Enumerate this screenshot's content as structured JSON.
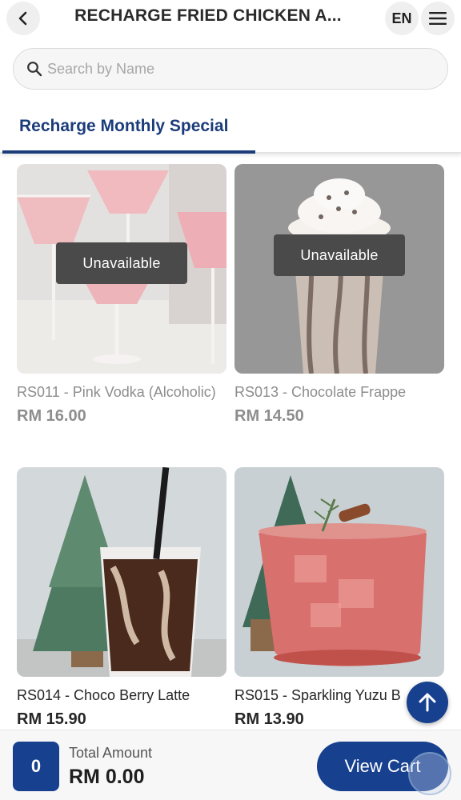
{
  "header": {
    "title": "RECHARGE FRIED CHICKEN A...",
    "language": "EN"
  },
  "search": {
    "placeholder": "Search by Name"
  },
  "tabs": [
    {
      "label": "Recharge Monthly Special",
      "active": true
    }
  ],
  "products": [
    {
      "name": "RS011 - Pink Vodka (Alcoholic)",
      "price": "RM 16.00",
      "status": "Unavailable",
      "image": "pink-cocktail-glasses"
    },
    {
      "name": "RS013 - Chocolate Frappe",
      "price": "RM 14.50",
      "status": "Unavailable",
      "image": "chocolate-frappe-cup"
    },
    {
      "name": "RS014 - Choco Berry Latte",
      "price": "RM 15.90",
      "status": "",
      "image": "iced-choco-latte-glass"
    },
    {
      "name": "RS015 - Sparkling Yuzu B",
      "price": "RM 13.90",
      "status": "",
      "image": "red-sparkling-drink"
    }
  ],
  "cart": {
    "count": "0",
    "total_label": "Total Amount",
    "total_value": "RM 0.00",
    "view_cart_label": "View Cart"
  },
  "colors": {
    "primary": "#17408f",
    "tab_accent": "#1b3c7a",
    "badge": "#4a4a4a"
  }
}
